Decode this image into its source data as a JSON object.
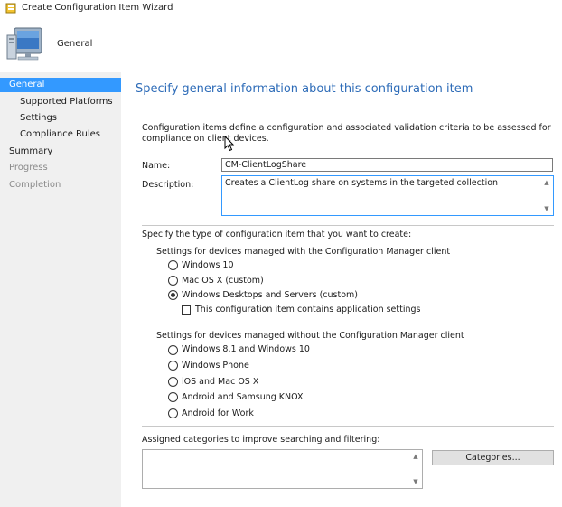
{
  "window": {
    "title": "Create Configuration Item Wizard"
  },
  "header": {
    "page_label": "General"
  },
  "nav": {
    "items": [
      {
        "label": "General",
        "state": "selected"
      },
      {
        "label": "Supported Platforms",
        "state": "normal"
      },
      {
        "label": "Settings",
        "state": "normal"
      },
      {
        "label": "Compliance Rules",
        "state": "normal"
      },
      {
        "label": "Summary",
        "state": "normal"
      },
      {
        "label": "Progress",
        "state": "disabled"
      },
      {
        "label": "Completion",
        "state": "disabled"
      }
    ]
  },
  "main": {
    "heading": "Specify general information about this configuration item",
    "intro": "Configuration items define a configuration and associated validation criteria to be assessed for compliance on client devices.",
    "name_label": "Name:",
    "name_value": "CM-ClientLogShare",
    "description_label": "Description:",
    "description_value": "Creates a ClientLog share on systems in the targeted collection",
    "type_prompt": "Specify the type of configuration item that you want to create:",
    "group_with_client": {
      "label": "Settings for devices managed with the Configuration Manager client",
      "options": [
        {
          "label": "Windows 10",
          "selected": false
        },
        {
          "label": "Mac OS X (custom)",
          "selected": false
        },
        {
          "label": "Windows Desktops and Servers (custom)",
          "selected": true
        }
      ],
      "app_settings_checkbox": {
        "label": "This configuration item contains application settings",
        "checked": false
      }
    },
    "group_without_client": {
      "label": "Settings for devices managed without the Configuration Manager client",
      "options": [
        {
          "label": "Windows 8.1 and Windows 10",
          "selected": false
        },
        {
          "label": "Windows Phone",
          "selected": false
        },
        {
          "label": "iOS and Mac OS X",
          "selected": false
        },
        {
          "label": "Android and Samsung KNOX",
          "selected": false
        },
        {
          "label": "Android for Work",
          "selected": false
        }
      ]
    },
    "categories_label": "Assigned categories to improve searching and filtering:",
    "categories_value": "",
    "categories_button": "Categories..."
  },
  "colors": {
    "accent": "#3399ff",
    "heading": "#2e6cb8",
    "nav_background": "#f0f0f0",
    "disabled_text": "#8a8a8a"
  },
  "icons": {
    "window": "wizard-icon",
    "header": "computer-icon",
    "pointer": "mouse-cursor-icon"
  }
}
